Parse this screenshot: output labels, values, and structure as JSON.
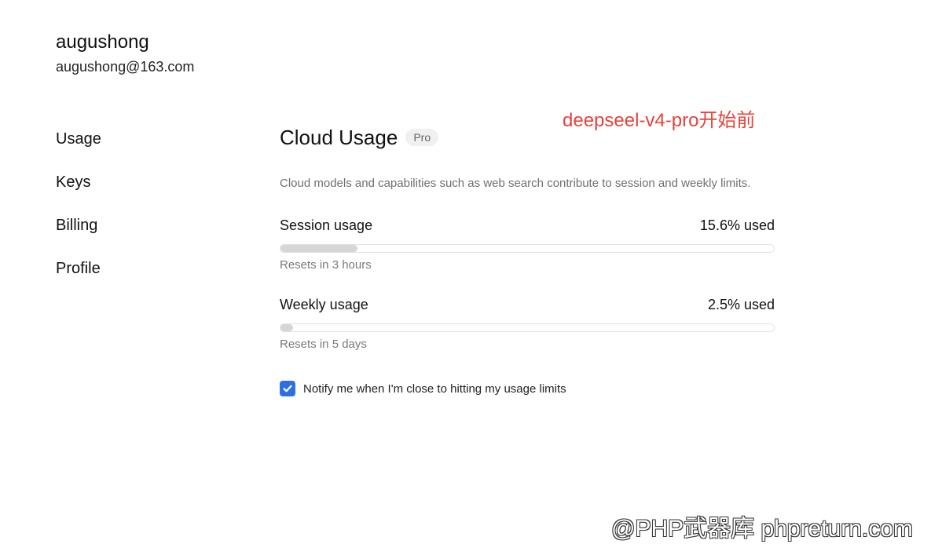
{
  "user": {
    "name": "augushong",
    "email": "augushong@163.com"
  },
  "sidebar": {
    "items": [
      {
        "label": "Usage"
      },
      {
        "label": "Keys"
      },
      {
        "label": "Billing"
      },
      {
        "label": "Profile"
      }
    ]
  },
  "annotation": "deepseel-v4-pro开始前",
  "main": {
    "title": "Cloud Usage",
    "badge": "Pro",
    "description": "Cloud models and capabilities such as web search contribute to session and weekly limits.",
    "session": {
      "label": "Session usage",
      "value_text": "15.6% used",
      "percent": 15.6,
      "reset": "Resets in 3 hours"
    },
    "weekly": {
      "label": "Weekly usage",
      "value_text": "2.5% used",
      "percent": 2.5,
      "reset": "Resets in 5 days"
    },
    "notify": {
      "label": "Notify me when I'm close to hitting my usage limits",
      "checked": true
    }
  },
  "colors": {
    "accent": "#2f6fe4",
    "annotation": "#e8413a",
    "bar_fill": "#d6d6d6"
  },
  "watermark": "@PHP武器库 phpreturn.com"
}
